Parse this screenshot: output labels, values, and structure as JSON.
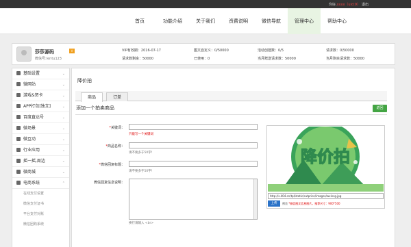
{
  "topbar": {
    "welcome": "你好,",
    "user_text": "xxxx（uid:9）",
    "logout": "退出"
  },
  "nav": {
    "items": [
      "首页",
      "功能介绍",
      "关于我们",
      "资费说明",
      "微信导航",
      "管理中心",
      "帮助中心"
    ],
    "active_index": 5
  },
  "profile": {
    "name": "莎莎源码",
    "badge": "V",
    "wechat": "微信号:lentu123",
    "stats": {
      "vip": "VIP有效期：2016-07-17",
      "req_left": "请求数剩余：50000",
      "diy_reply": "图文自定义：0/50000",
      "used": "已使用：0",
      "activity": "活动创建数：0/5",
      "month_req_left": "当月赠送请求数：50000",
      "req_count": "请求数：0/50000",
      "month_gift_left": "当月剩余请求数：50000"
    }
  },
  "sidebar": {
    "items": [
      "基础设置",
      "微网站",
      "游戏&贺卡",
      "APP打包[独立]",
      "百度直达号",
      "微场景",
      "微互动",
      "行业应用",
      "摇一摇,周边",
      "微商城",
      "电商系统"
    ],
    "sub_items": [
      "在线支付设置",
      "微信支付证书",
      "平台支付对账",
      "微信团购系统"
    ]
  },
  "main": {
    "page_title": "降价拍",
    "tabs": [
      "商品",
      "订单"
    ],
    "form_title": "添加一个拍卖商品",
    "back_label": "返回",
    "fields": {
      "keyword_label": "关键词：",
      "keyword_hint": "只能写一个关键词",
      "name_label": "商品名称：",
      "name_hint": "请不要多于50字!",
      "reply_title_label": "微信回复标题：",
      "reply_title_hint": "请不要多于50字!",
      "reply_desc_label": "微信回复信息说明：",
      "reply_desc_hint": "换行请输入 <br>"
    },
    "image": {
      "banner_text": "降价拍",
      "url": "http://s.404.cn/tpl/static/cutprice/images/wxinsg.jpg",
      "upload_label": "上传",
      "preview_label": "预览",
      "hint": "*微信图文信息图片，推荐尺寸：900*500"
    }
  }
}
